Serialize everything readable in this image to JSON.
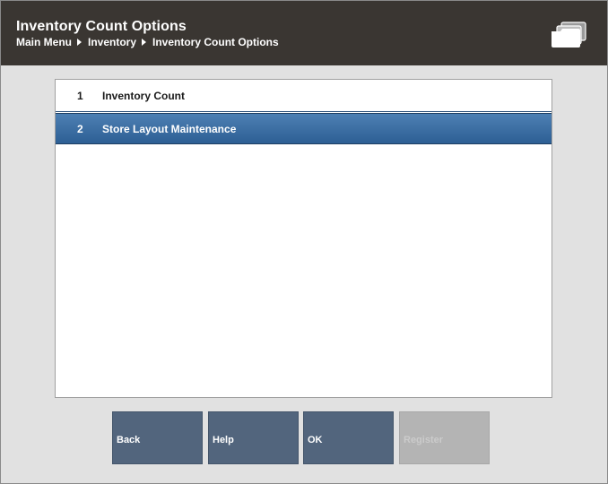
{
  "header": {
    "title": "Inventory Count Options",
    "breadcrumb": [
      "Main Menu",
      "Inventory",
      "Inventory Count Options"
    ]
  },
  "list": {
    "items": [
      {
        "number": "1",
        "label": "Inventory Count",
        "selected": false
      },
      {
        "number": "2",
        "label": "Store Layout Maintenance",
        "selected": true
      }
    ]
  },
  "buttons": {
    "back": "Back",
    "help": "Help",
    "ok": "OK",
    "register": "Register"
  },
  "colors": {
    "header_bg": "#3a3632",
    "selected_row": "#3c6fa3",
    "button_bg": "#52657d",
    "button_disabled": "#b4b4b4",
    "page_bg": "#e1e1e1"
  }
}
